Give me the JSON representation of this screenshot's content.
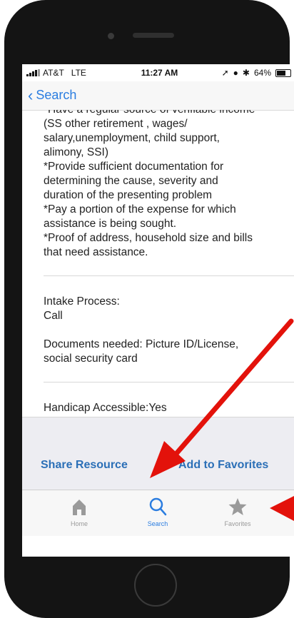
{
  "status_bar": {
    "carrier": "AT&T",
    "network": "LTE",
    "time": "11:27 AM",
    "battery": "64%"
  },
  "nav": {
    "back_label": "Search"
  },
  "content": {
    "partial_top_line": "*Have a regular source of verifiable income",
    "eligibility_lines": [
      "(SS other retirement , wages/",
      "salary,unemployment, child support,",
      "alimony, SSI)",
      "*Provide sufficient documentation for",
      "determining the cause, severity and",
      "duration of the presenting problem",
      "*Pay a portion of the expense for which",
      "assistance is being sought.",
      "*Proof of address, household size and bills",
      "that need assistance."
    ],
    "intake_label": "Intake Process:",
    "intake_value": "Call",
    "documents_line1": "Documents needed: Picture ID/License,",
    "documents_line2": "social security card",
    "handicap": "Handicap Accessible:Yes"
  },
  "actions": {
    "share_label": "Share Resource",
    "favorites_label": "Add to Favorites"
  },
  "tab_bar": {
    "tabs": [
      {
        "label": "Home",
        "icon": "home-icon"
      },
      {
        "label": "Search",
        "icon": "search-icon"
      },
      {
        "label": "Favorites",
        "icon": "star-icon"
      }
    ],
    "active": "Search"
  },
  "colors": {
    "accent": "#2b7de0",
    "action_text": "#2b6fb7",
    "annotation_arrow": "#e3120b",
    "phone_body": "#141414"
  }
}
